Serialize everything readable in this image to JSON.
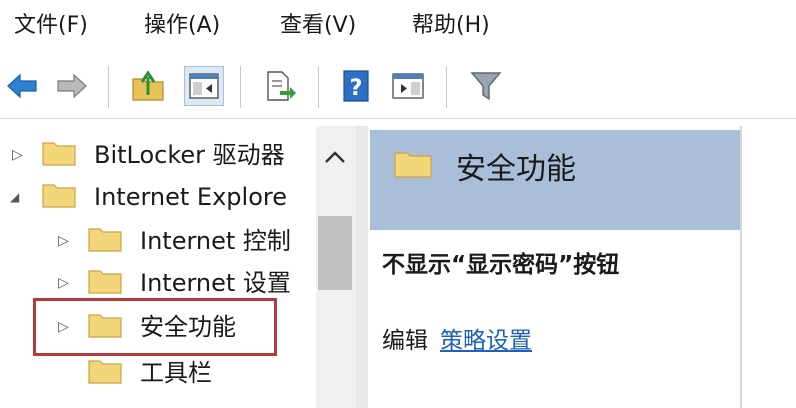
{
  "menubar": {
    "file": "文件(F)",
    "action": "操作(A)",
    "view": "查看(V)",
    "help": "帮助(H)"
  },
  "toolbar": {
    "buttons": [
      "back-arrow-icon",
      "forward-arrow-icon",
      "up-folder-icon",
      "show-hide-console-tree-icon",
      "export-list-icon",
      "help-icon",
      "show-action-pane-icon",
      "filter-icon"
    ]
  },
  "tree": {
    "items": [
      {
        "label": "BitLocker 驱动器",
        "expander": "▷"
      },
      {
        "label": "Internet Explore",
        "expander": "◢"
      },
      {
        "label": "Internet 控制",
        "expander": "▷"
      },
      {
        "label": "Internet 设置",
        "expander": "▷"
      },
      {
        "label": "安全功能",
        "expander": "▷"
      },
      {
        "label": "工具栏",
        "expander": ""
      }
    ]
  },
  "details": {
    "title": "安全功能",
    "policy_name": "不显示“显示密码”按钮",
    "edit_prefix": "编辑",
    "policy_link": "策略设置"
  },
  "colors": {
    "header_band": "#a9bfd9",
    "highlight_border": "#b33b3b",
    "link": "#1f5fbf",
    "folder": "#f3d57a"
  }
}
